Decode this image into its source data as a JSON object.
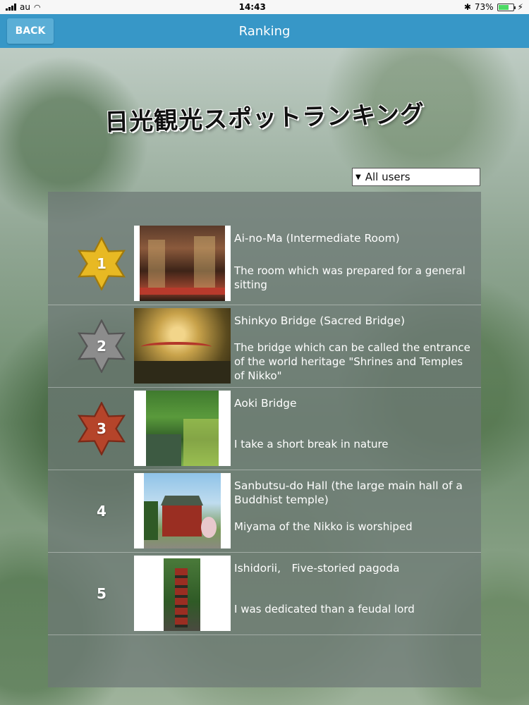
{
  "status": {
    "carrier": "au",
    "time": "14:43",
    "battery": "73%"
  },
  "nav": {
    "back_label": "BACK",
    "title": "Ranking"
  },
  "heading": "日光観光スポットランキング",
  "filter": {
    "selected": "All users"
  },
  "ranking": [
    {
      "rank": "1",
      "title": "Ai-no-Ma (Intermediate Room)",
      "desc": "The room which was prepared for a general sitting",
      "badge_color": "#e8b923"
    },
    {
      "rank": "2",
      "title": "Shinkyo Bridge (Sacred Bridge)",
      "desc": "The bridge which can be called the entrance of the world heritage \"Shrines and Temples of Nikko\"",
      "badge_color": "#8c8c8c"
    },
    {
      "rank": "3",
      "title": "Aoki Bridge",
      "desc": "I take a short break in nature",
      "badge_color": "#b5442a"
    },
    {
      "rank": "4",
      "title": "Sanbutsu-do Hall (the large main hall of a Buddhist temple)",
      "desc": "Miyama of the Nikko is worshiped"
    },
    {
      "rank": "5",
      "title": "Ishidorii,　Five-storied pagoda",
      "desc": "I was dedicated than a feudal lord"
    }
  ]
}
